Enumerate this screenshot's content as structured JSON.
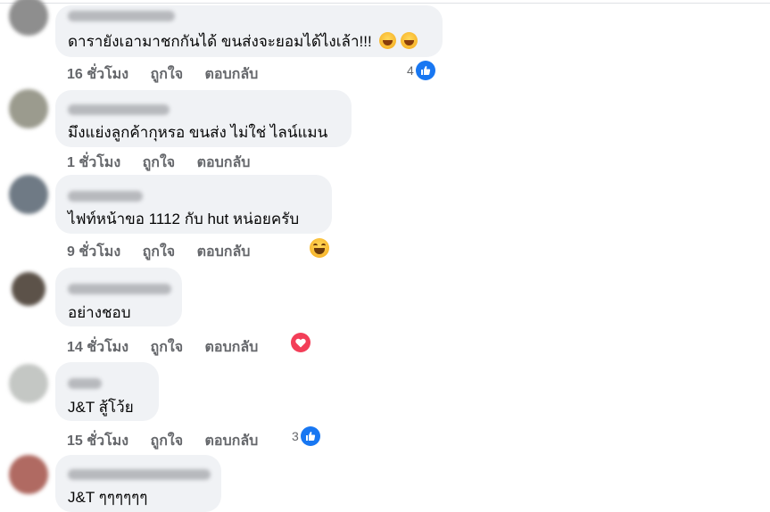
{
  "comments": [
    {
      "text": "ดารายังเอามาชกกันได้ ขนส่งจะยอมได้ไงเล้า!!!",
      "emoji_suffix": [
        "laughing-emoji",
        "laughing-emoji"
      ],
      "time": "16 ชั่วโมง",
      "like": "ถูกใจ",
      "reply": "ตอบกลับ",
      "reaction_count": "4",
      "reaction_icon": "like-icon"
    },
    {
      "text": "มึงแย่งลูกค้ากุหรอ ขนส่ง ไม่ใช่ ไลน์แมน",
      "time": "1 ชั่วโมง",
      "like": "ถูกใจ",
      "reply": "ตอบกลับ"
    },
    {
      "text": "ไฟท์หน้าขอ 1112 กับ hut หน่อยครับ",
      "time": "9 ชั่วโมง",
      "like": "ถูกใจ",
      "reply": "ตอบกลับ",
      "reaction_icon": "haha-icon"
    },
    {
      "text": "อย่างชอบ",
      "time": "14 ชั่วโมง",
      "like": "ถูกใจ",
      "reply": "ตอบกลับ",
      "reaction_icon": "love-icon"
    },
    {
      "text": "J&T สู้โว้ย",
      "time": "15 ชั่วโมง",
      "like": "ถูกใจ",
      "reply": "ตอบกลับ",
      "reaction_count": "3",
      "reaction_icon": "like-icon"
    },
    {
      "text": "J&T ๆๆๆๆๆๆ"
    }
  ],
  "colors": {
    "bubble": "#f0f2f5",
    "meta_text": "#65676b",
    "like_blue": "#1877f2",
    "love_red": "#f33e58"
  }
}
